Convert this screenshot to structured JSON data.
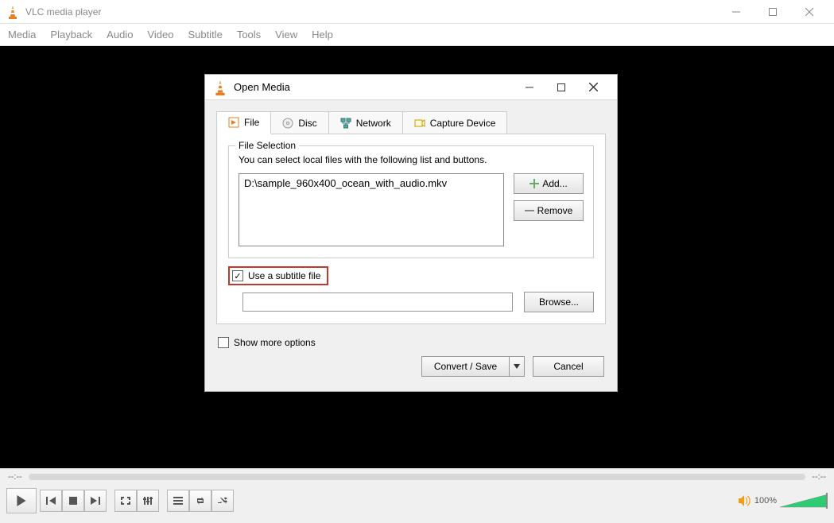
{
  "window": {
    "title": "VLC media player"
  },
  "menu": {
    "items": [
      "Media",
      "Playback",
      "Audio",
      "Video",
      "Subtitle",
      "Tools",
      "View",
      "Help"
    ]
  },
  "timebar": {
    "elapsed": "--:--",
    "total": "--:--"
  },
  "volume": {
    "percent": "100%"
  },
  "dialog": {
    "title": "Open Media",
    "tabs": {
      "file": "File",
      "disc": "Disc",
      "network": "Network",
      "capture": "Capture Device"
    },
    "file_selection": {
      "legend": "File Selection",
      "help": "You can select local files with the following list and buttons.",
      "files": [
        "D:\\sample_960x400_ocean_with_audio.mkv"
      ],
      "add": "Add...",
      "remove": "Remove"
    },
    "subtitle": {
      "label": "Use a subtitle file",
      "checked": true,
      "browse": "Browse..."
    },
    "more": "Show more options",
    "convert": "Convert / Save",
    "cancel": "Cancel"
  }
}
